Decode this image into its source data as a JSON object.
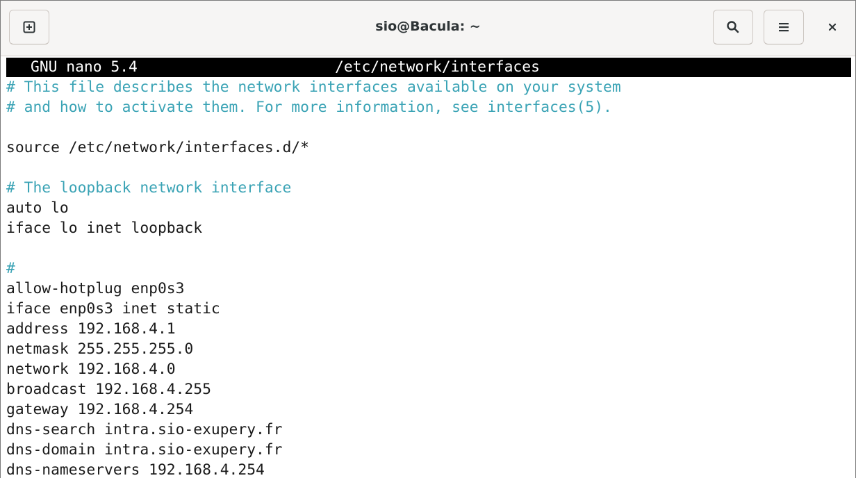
{
  "window": {
    "title": "sio@Bacula: ~",
    "icons": {
      "new_tab": "new-tab-icon",
      "search": "search-icon",
      "menu": "hamburger-menu-icon",
      "close": "close-icon"
    }
  },
  "editor": {
    "app_version": "GNU nano 5.4",
    "file_path": "/etc/network/interfaces",
    "comment_color": "#3aa3b5",
    "lines": [
      {
        "text": "# This file describes the network interfaces available on your system",
        "type": "comment"
      },
      {
        "text": "# and how to activate them. For more information, see interfaces(5).",
        "type": "comment"
      },
      {
        "text": "",
        "type": "text"
      },
      {
        "text": "source /etc/network/interfaces.d/*",
        "type": "text"
      },
      {
        "text": "",
        "type": "text"
      },
      {
        "text": "# The loopback network interface",
        "type": "comment"
      },
      {
        "text": "auto lo",
        "type": "text"
      },
      {
        "text": "iface lo inet loopback",
        "type": "text"
      },
      {
        "text": "",
        "type": "text"
      },
      {
        "text": "#",
        "type": "comment"
      },
      {
        "text": "allow-hotplug enp0s3",
        "type": "text"
      },
      {
        "text": "iface enp0s3 inet static",
        "type": "text"
      },
      {
        "text": "address 192.168.4.1",
        "type": "text"
      },
      {
        "text": "netmask 255.255.255.0",
        "type": "text"
      },
      {
        "text": "network 192.168.4.0",
        "type": "text"
      },
      {
        "text": "broadcast 192.168.4.255",
        "type": "text"
      },
      {
        "text": "gateway 192.168.4.254",
        "type": "text"
      },
      {
        "text": "dns-search intra.sio-exupery.fr",
        "type": "text"
      },
      {
        "text": "dns-domain intra.sio-exupery.fr",
        "type": "text"
      },
      {
        "text": "dns-nameservers 192.168.4.254",
        "type": "text"
      }
    ]
  }
}
